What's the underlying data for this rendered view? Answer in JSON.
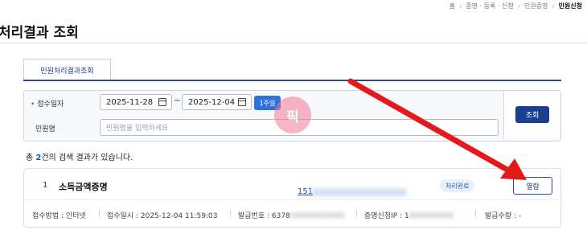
{
  "breadcrumb": {
    "home": "홈",
    "items": [
      "증명 · 등록 · 신청",
      "민원증명"
    ],
    "current": "민원신청"
  },
  "page": {
    "title": "처리결과 조회"
  },
  "tabs": [
    {
      "label": "민원처리결과조회",
      "active": true
    }
  ],
  "form": {
    "date_label": "접수일자",
    "required_mark": "•",
    "date_from": "2025-11-28",
    "date_sep": "~",
    "date_to": "2025-12-04",
    "period_button": "1주일",
    "name_label": "민원명",
    "name_placeholder": "민원명을 입력하세요",
    "search_button": "조회"
  },
  "result_summary": {
    "prefix": "총 ",
    "count": "2",
    "suffix": "건의 검색 결과가 있습니다."
  },
  "results": [
    {
      "index": "1",
      "title": "소득금액증명",
      "number_visible": "151",
      "number_hidden": "XXXXXXXXXXXXXXXXX",
      "status": "처리완료",
      "view_button": "열람",
      "meta": {
        "method": "접수방법 : 인터넷",
        "received": "접수일시 : 2025-12-04 11:59:03",
        "issue_no_label": "발급번호 : 6378",
        "issue_no_hidden": "XXXXXXXXXXX",
        "ip_label": "증명신청IP : 1",
        "ip_hidden": "XXXXXXXXX",
        "quantity": "발급수량 : -"
      }
    }
  ],
  "watermark": {
    "text": "픽"
  },
  "colors": {
    "accent": "#2f72de",
    "navy": "#1b3f8f",
    "arrow": "#e5191b",
    "link": "#1a4cbf"
  }
}
